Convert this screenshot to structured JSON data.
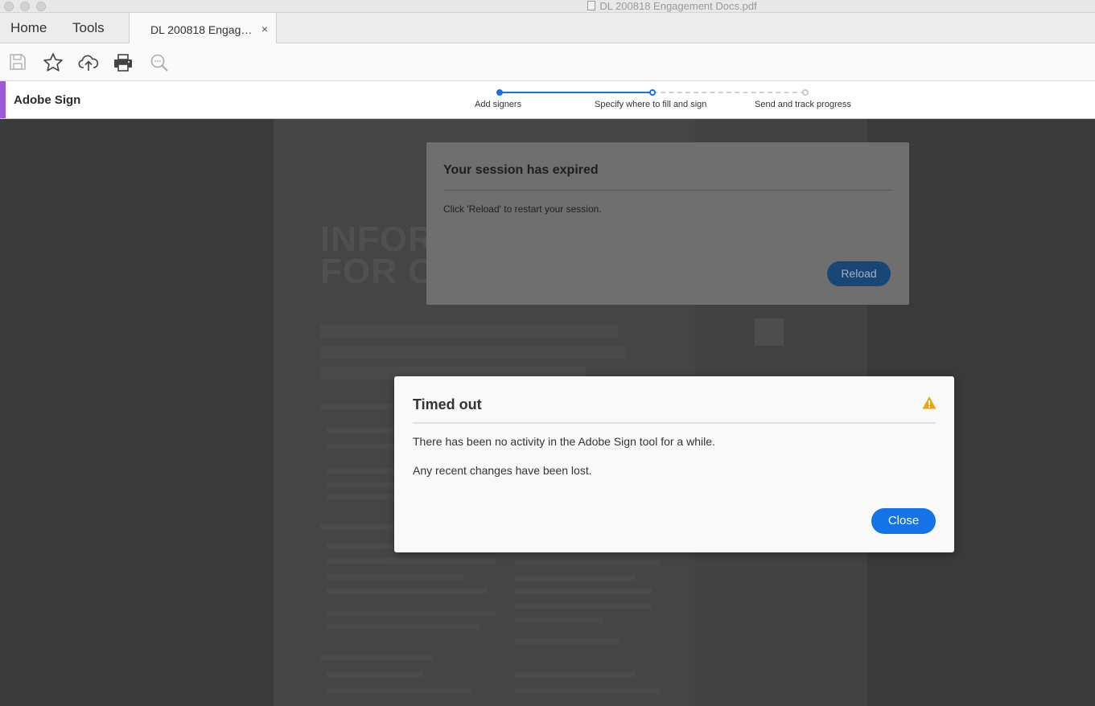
{
  "window": {
    "title": "DL 200818 Engagement Docs.pdf"
  },
  "tabs": {
    "home": "Home",
    "tools": "Tools",
    "document_tab": "DL 200818 Engag…",
    "close_glyph": "×"
  },
  "toolbar": {
    "icons": [
      "save-icon",
      "bookmark-star-icon",
      "cloud-upload-icon",
      "print-icon",
      "search-zoom-icon"
    ]
  },
  "sign": {
    "title": "Adobe Sign",
    "steps": [
      {
        "label": "Add signers",
        "state": "done"
      },
      {
        "label": "Specify where to fill and sign",
        "state": "current"
      },
      {
        "label": "Send and track progress",
        "state": "upcoming"
      }
    ],
    "accent_color": "#9b59d6",
    "step_color": "#1473e6"
  },
  "background_document": {
    "heading_line1": "INFOR",
    "heading_line2": "FOR C"
  },
  "session_modal": {
    "title": "Your session has expired",
    "message": "Click 'Reload' to restart your session.",
    "reload_label": "Reload"
  },
  "timeout_modal": {
    "title": "Timed out",
    "line1": "There has been no activity in the Adobe Sign tool for a while.",
    "line2": "Any recent changes have been lost.",
    "close_label": "Close",
    "warning_color": "#f0a30a",
    "button_color": "#1473e6"
  }
}
